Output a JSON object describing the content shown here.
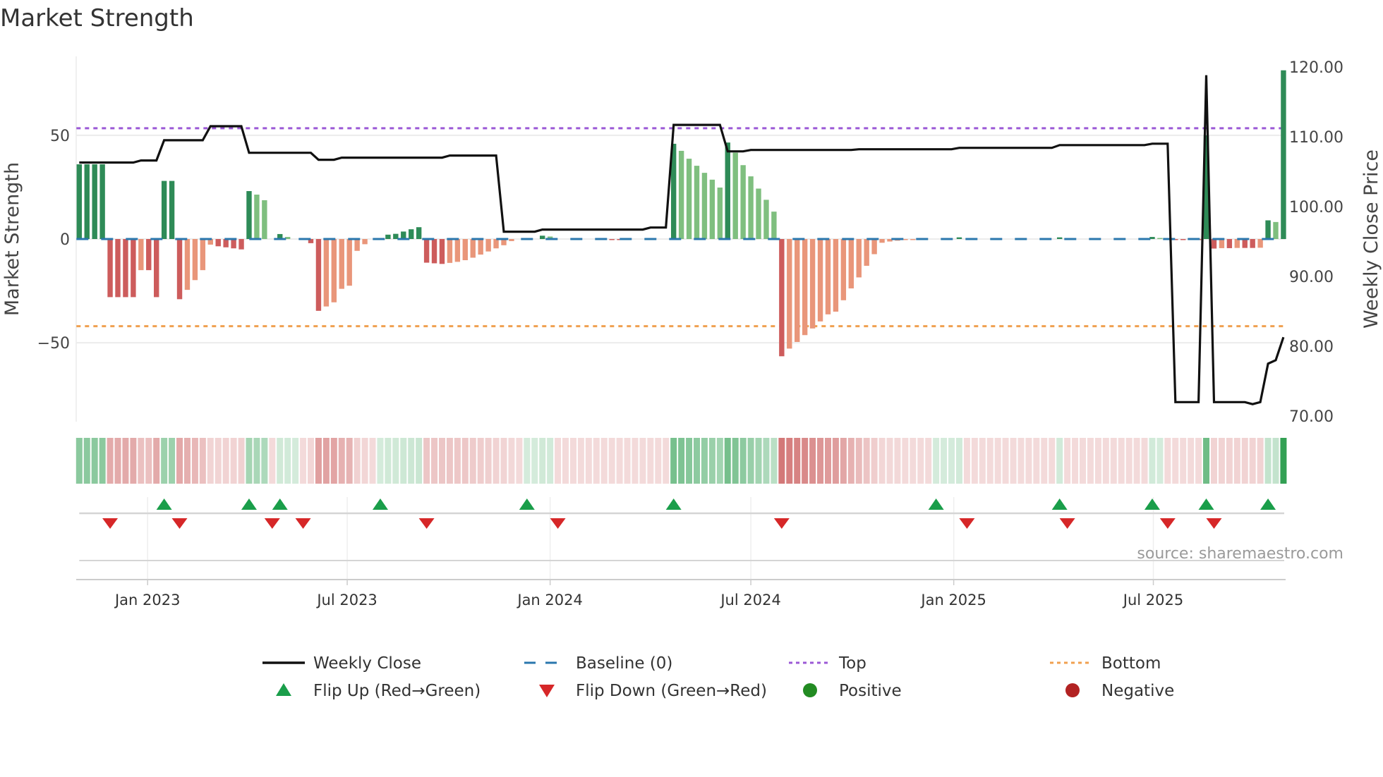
{
  "title": "Market Strength",
  "source": "source: sharemaestro.com",
  "colors": {
    "bar_strong_pos": "#2e8b57",
    "bar_weak_pos": "#7fbf7f",
    "bar_strong_neg": "#cd5c5c",
    "bar_weak_neg": "#e9967a",
    "weekly_close": "#111111",
    "baseline": "#2a77ad",
    "top": "#9b59d6",
    "bottom": "#f0a050",
    "flip_up": "#1a9e4a",
    "flip_down": "#d62728",
    "positive": "#228b22",
    "negative": "#b22222"
  },
  "chart_data": {
    "type": "bar",
    "title": "Market Strength",
    "ylabel": "Market Strength",
    "ylabel_right": "Weekly Close Price",
    "ylim": [
      -88,
      88
    ],
    "ylim_right": [
      69.2,
      121.5
    ],
    "x_start": "2022-10-31",
    "x_interval_days": 7,
    "baseline": 0,
    "top_level": 53.4,
    "bottom_level": -42,
    "yticks": [
      {
        "value": 50,
        "label": "50"
      },
      {
        "value": 0,
        "label": "0"
      },
      {
        "value": -50,
        "label": "−50"
      }
    ],
    "yticks_right": [
      {
        "value": 120,
        "label": "120.00"
      },
      {
        "value": 110,
        "label": "110.00"
      },
      {
        "value": 100,
        "label": "100.00"
      },
      {
        "value": 90,
        "label": "90.00"
      },
      {
        "value": 80,
        "label": "80.00"
      },
      {
        "value": 70,
        "label": "70.00"
      }
    ],
    "xticks": [
      {
        "date": "2023-01-01",
        "label": "Jan 2023"
      },
      {
        "date": "2023-07-01",
        "label": "Jul 2023"
      },
      {
        "date": "2024-01-01",
        "label": "Jan 2024"
      },
      {
        "date": "2024-07-01",
        "label": "Jul 2024"
      },
      {
        "date": "2025-01-01",
        "label": "Jan 2025"
      },
      {
        "date": "2025-07-01",
        "label": "Jul 2025"
      }
    ],
    "strength": [
      36,
      36,
      36,
      36,
      -28,
      -28,
      -28,
      -28,
      -15,
      -15,
      -28,
      28,
      28,
      -29,
      -24.5,
      -19.8,
      -15,
      -2.7,
      -3.5,
      -4,
      -4.5,
      -5,
      23.1,
      21.4,
      18.7,
      0,
      2.4,
      1,
      0,
      -0.5,
      -2,
      -34.6,
      -32.5,
      -30.5,
      -24,
      -22.5,
      -5.7,
      -2.5,
      0,
      0.4,
      2.1,
      2.5,
      3.6,
      4.7,
      5.7,
      -11.4,
      -11.7,
      -12,
      -11.5,
      -11,
      -10.2,
      -9,
      -7.5,
      -6,
      -4.5,
      -3,
      -1,
      0,
      0,
      0,
      1.6,
      1.2,
      0,
      0,
      0,
      0,
      0,
      0,
      -0.3,
      -0.3,
      -0.3,
      -0.3,
      0,
      0,
      0,
      0,
      0,
      45.9,
      42.5,
      38.7,
      35.3,
      31.9,
      28.6,
      24.8,
      46.5,
      41.6,
      35.6,
      30.2,
      24.3,
      18.9,
      13.2,
      -56.5,
      -52.8,
      -49.6,
      -46.3,
      -43.1,
      -39.7,
      -36.3,
      -35,
      -29.5,
      -23.8,
      -18.5,
      -12.9,
      -7.3,
      -1.8,
      -1.2,
      -0.8,
      -0.5,
      -0.3,
      0,
      0,
      0,
      0,
      0,
      0.8,
      0,
      0,
      0,
      0,
      0,
      0,
      0,
      0,
      0,
      0,
      0,
      0,
      0.8,
      0,
      0,
      0,
      0,
      0,
      0,
      0,
      0,
      0,
      0,
      0,
      1.0,
      0.5,
      0,
      -0.3,
      -0.3,
      -0.3,
      -0.3,
      50,
      -4.6,
      -4.4,
      -4.4,
      -4.3,
      -4.3,
      -4.3,
      -4.2,
      9.0,
      8.2,
      81.3
    ],
    "weekly_close": [
      106.3,
      106.3,
      106.3,
      106.3,
      106.3,
      106.3,
      106.3,
      106.3,
      106.6,
      106.6,
      106.6,
      109.5,
      109.5,
      109.5,
      109.5,
      109.5,
      109.5,
      111.5,
      111.5,
      111.5,
      111.5,
      111.5,
      107.7,
      107.7,
      107.7,
      107.7,
      107.7,
      107.7,
      107.7,
      107.7,
      107.7,
      106.7,
      106.7,
      106.7,
      107.0,
      107.0,
      107.0,
      107.0,
      107.0,
      107.0,
      107.0,
      107.0,
      107.0,
      107.0,
      107.0,
      107.0,
      107.0,
      107.0,
      107.3,
      107.3,
      107.3,
      107.3,
      107.3,
      107.3,
      107.3,
      96.4,
      96.4,
      96.4,
      96.4,
      96.4,
      96.7,
      96.7,
      96.7,
      96.7,
      96.7,
      96.7,
      96.7,
      96.7,
      96.7,
      96.7,
      96.7,
      96.7,
      96.7,
      96.7,
      97.0,
      97.0,
      97.0,
      111.7,
      111.7,
      111.7,
      111.7,
      111.7,
      111.7,
      111.7,
      107.9,
      107.9,
      107.9,
      108.1,
      108.1,
      108.1,
      108.1,
      108.1,
      108.1,
      108.1,
      108.1,
      108.1,
      108.1,
      108.1,
      108.1,
      108.1,
      108.1,
      108.2,
      108.2,
      108.2,
      108.2,
      108.2,
      108.2,
      108.2,
      108.2,
      108.2,
      108.2,
      108.2,
      108.2,
      108.2,
      108.4,
      108.4,
      108.4,
      108.4,
      108.4,
      108.4,
      108.4,
      108.4,
      108.4,
      108.4,
      108.4,
      108.4,
      108.4,
      108.8,
      108.8,
      108.8,
      108.8,
      108.8,
      108.8,
      108.8,
      108.8,
      108.8,
      108.8,
      108.8,
      108.8,
      109.0,
      109.0,
      109.0,
      72.0,
      72.0,
      72.0,
      72.0,
      118.8,
      72.0,
      72.0,
      72.0,
      72.0,
      72.0,
      71.7,
      72.0,
      77.5,
      78.0,
      81.3
    ],
    "flip_up": [
      11,
      22,
      26,
      39,
      58,
      77,
      111,
      127,
      139,
      146,
      154
    ],
    "flip_down": [
      4,
      13,
      25,
      29,
      45,
      62,
      91,
      115,
      128,
      141,
      147
    ],
    "legend": [
      {
        "label": "Weekly Close",
        "symbol": "line"
      },
      {
        "label": "Baseline (0)",
        "symbol": "dash"
      },
      {
        "label": "Top",
        "symbol": "dot-purple"
      },
      {
        "label": "Bottom",
        "symbol": "dot-orange"
      },
      {
        "label": "Flip Up (Red→Green)",
        "symbol": "triangle-up"
      },
      {
        "label": "Flip Down (Green→Red)",
        "symbol": "triangle-down"
      },
      {
        "label": "Positive",
        "symbol": "circle-green"
      },
      {
        "label": "Negative",
        "symbol": "circle-red"
      }
    ]
  }
}
